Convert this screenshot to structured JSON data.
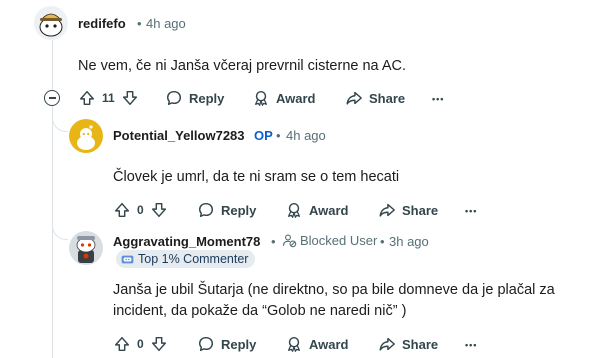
{
  "comments": [
    {
      "author": "redifefo",
      "time": "4h ago",
      "body": "Ne vem, če ni Janša včeraj prevrnil cisterne na AC.",
      "votes": "11",
      "actions": {
        "reply": "Reply",
        "award": "Award",
        "share": "Share"
      }
    },
    {
      "author": "Potential_Yellow7283",
      "op_badge": "OP",
      "time": "4h ago",
      "body": "Človek je umrl, da te ni sram se o tem hecati",
      "votes": "0",
      "actions": {
        "reply": "Reply",
        "award": "Award",
        "share": "Share"
      }
    },
    {
      "author": "Aggravating_Moment78",
      "blocked": "Blocked User",
      "time": "3h ago",
      "flair": "Top 1% Commenter",
      "body_lines": [
        "Janša je ubil Šutarja (ne direktno, so pa bile domneve da je plačal za",
        "incident, da pokaže da “Golob ne naredi nič” )"
      ],
      "votes": "0",
      "actions": {
        "reply": "Reply",
        "award": "Award",
        "share": "Share"
      }
    }
  ],
  "separator": "•",
  "more_glyph": "•••",
  "colors": {
    "op": "#0a5fcc",
    "meta": "#576f76",
    "thread_line": "#dde3e6",
    "flair_bg": "#e5ebee"
  }
}
